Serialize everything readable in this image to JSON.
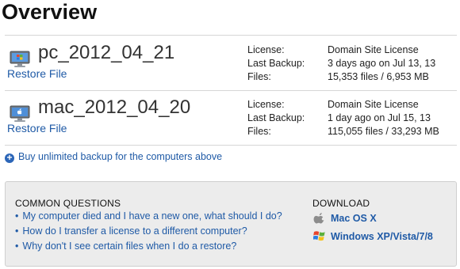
{
  "page": {
    "title": "Overview"
  },
  "computers": [
    {
      "name": "pc_2012_04_21",
      "icon": "windows-monitor-icon",
      "restore_label": "Restore File",
      "details": [
        {
          "label": "License:",
          "value": "Domain Site License"
        },
        {
          "label": "Last Backup:",
          "value": "3 days ago on Jul 13, 13"
        },
        {
          "label": "Files:",
          "value": "15,353 files / 6,953 MB"
        }
      ]
    },
    {
      "name": "mac_2012_04_20",
      "icon": "mac-monitor-icon",
      "restore_label": "Restore File",
      "details": [
        {
          "label": "License:",
          "value": "Domain Site License"
        },
        {
          "label": "Last Backup:",
          "value": "1 day ago on Jul 15, 13"
        },
        {
          "label": "Files:",
          "value": "115,055 files / 33,293 MB"
        }
      ]
    }
  ],
  "buy": {
    "label": "Buy unlimited backup for the computers above",
    "icon": "plus-circle-icon"
  },
  "questions": {
    "heading": "COMMON QUESTIONS",
    "items": [
      "My computer died and I have a new one, what should I do?",
      "How do I transfer a license to a different computer?",
      "Why don't I see certain files when I do a restore?"
    ]
  },
  "download": {
    "heading": "DOWNLOAD",
    "items": [
      {
        "label": "Mac OS X",
        "icon": "apple-icon"
      },
      {
        "label": "Windows XP/Vista/7/8",
        "icon": "windows-flag-icon"
      }
    ]
  },
  "colors": {
    "link": "#1f5aa6",
    "panel_bg": "#ececec",
    "divider": "#d6d6d6"
  }
}
